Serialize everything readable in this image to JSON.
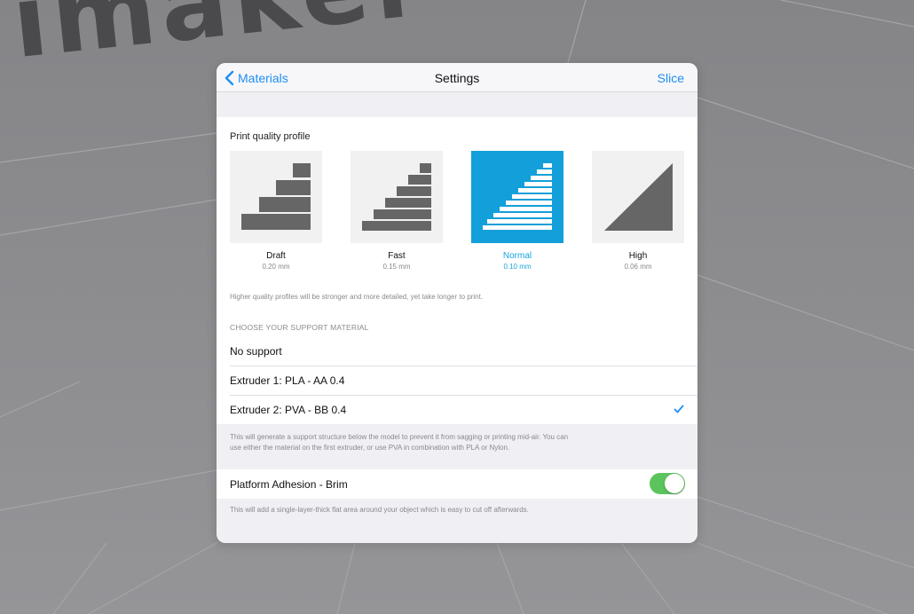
{
  "background": {
    "logo_text": "imaker"
  },
  "navbar": {
    "back_label": "Materials",
    "title": "Settings",
    "action_label": "Slice"
  },
  "quality": {
    "title": "Print quality profile",
    "profiles": [
      {
        "label": "Draft",
        "sub": "0.20 mm",
        "selected": false
      },
      {
        "label": "Fast",
        "sub": "0.15 mm",
        "selected": false
      },
      {
        "label": "Normal",
        "sub": "0.10 mm",
        "selected": true
      },
      {
        "label": "High",
        "sub": "0.06 mm",
        "selected": false
      }
    ],
    "note": "Higher quality profiles will be stronger and more detailed, yet take longer to print."
  },
  "support": {
    "header": "CHOOSE YOUR SUPPORT MATERIAL",
    "options": [
      {
        "label": "No support",
        "checked": false
      },
      {
        "label": "Extruder 1: PLA - AA 0.4",
        "checked": false
      },
      {
        "label": "Extruder 2: PVA - BB 0.4",
        "checked": true
      }
    ],
    "note_line1": "This will generate a support structure below the model to prevent it from sagging or printing mid-air. You can",
    "note_line2": "use either the material on the first extruder, or use PVA in combination with PLA or Nylon."
  },
  "adhesion": {
    "label": "Platform Adhesion - Brim",
    "enabled": true,
    "note": "This will add a single-layer-thick flat area around your object which is easy to cut off afterwards."
  },
  "colors": {
    "accent": "#1f8ef1",
    "selected_tile": "#139fd9",
    "toggle_on": "#5cc45c"
  }
}
